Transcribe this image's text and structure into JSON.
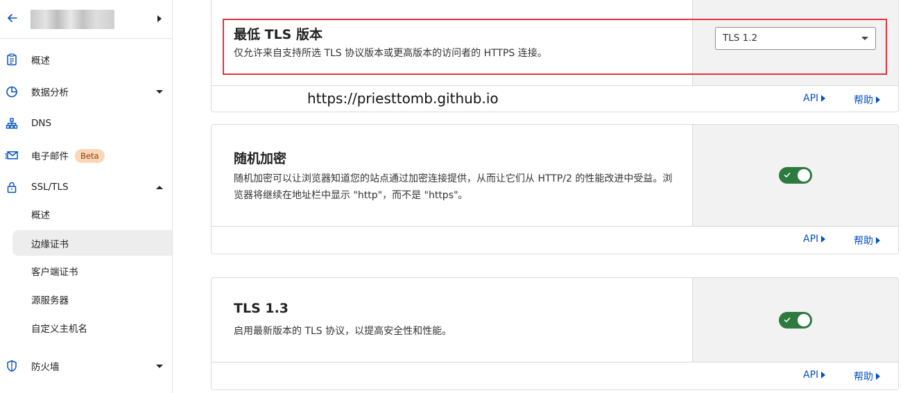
{
  "sidebar": {
    "back_icon": "arrow-left-icon",
    "account_caret_icon": "caret-right-icon",
    "items": [
      {
        "label": "概述",
        "icon": "clipboard-icon"
      },
      {
        "label": "数据分析",
        "icon": "pie-chart-icon"
      },
      {
        "label": "DNS",
        "icon": "network-icon"
      },
      {
        "label": "电子邮件",
        "icon": "envelope-icon",
        "badge": "Beta"
      },
      {
        "label": "SSL/TLS",
        "icon": "lock-icon"
      },
      {
        "label": "防火墙",
        "icon": "shield-icon"
      }
    ],
    "subitems": [
      {
        "label": "概述"
      },
      {
        "label": "边缘证书",
        "active": true
      },
      {
        "label": "客户端证书"
      },
      {
        "label": "源服务器"
      },
      {
        "label": "自定义主机名"
      }
    ]
  },
  "cards": [
    {
      "title": "最低 TLS 版本",
      "description": "仅允许来自支持所选 TLS 协议版本或更高版本的访问者的 HTTPS 连接。",
      "control": {
        "type": "select",
        "value": "TLS 1.2"
      },
      "footer": {
        "api": "API",
        "help": "帮助"
      }
    },
    {
      "title": "随机加密",
      "description": "随机加密可以让浏览器知道您的站点通过加密连接提供，从而让它们从 HTTP/2 的性能改进中受益。浏览器将继续在地址栏中显示 \"http\"，而不是 \"https\"。",
      "control": {
        "type": "toggle",
        "on": true
      },
      "footer": {
        "api": "API",
        "help": "帮助"
      }
    },
    {
      "title": "TLS 1.3",
      "description": "启用最新版本的 TLS 协议，以提高安全性和性能。",
      "control": {
        "type": "toggle",
        "on": true
      },
      "footer": {
        "api": "API",
        "help": "帮助"
      }
    }
  ],
  "watermark": "https://priesttomb.github.io",
  "colors": {
    "link": "#0051c3",
    "toggle_on": "#2d7a3e",
    "highlight": "#e0313b",
    "beta_bg": "#fbd7b8"
  }
}
